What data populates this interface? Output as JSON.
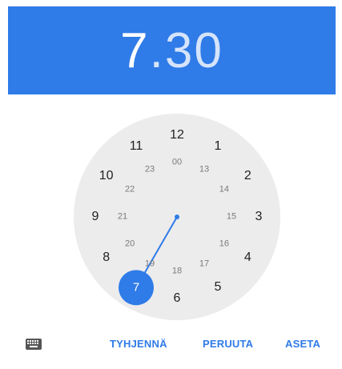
{
  "time": {
    "hour": "7",
    "separator": ".",
    "minute": "30"
  },
  "clock": {
    "outer_hours": [
      "12",
      "1",
      "2",
      "3",
      "4",
      "5",
      "6",
      "7",
      "8",
      "9",
      "10",
      "11"
    ],
    "inner_hours": [
      "00",
      "13",
      "14",
      "15",
      "16",
      "17",
      "18",
      "19",
      "20",
      "21",
      "22",
      "23"
    ],
    "selected_hour": "7",
    "accent_color": "#2f7be8",
    "face_color": "#ececec"
  },
  "actions": {
    "keyboard_icon": "keyboard-icon",
    "clear_label": "TYHJENNÄ",
    "cancel_label": "PERUUTA",
    "set_label": "ASETA"
  }
}
